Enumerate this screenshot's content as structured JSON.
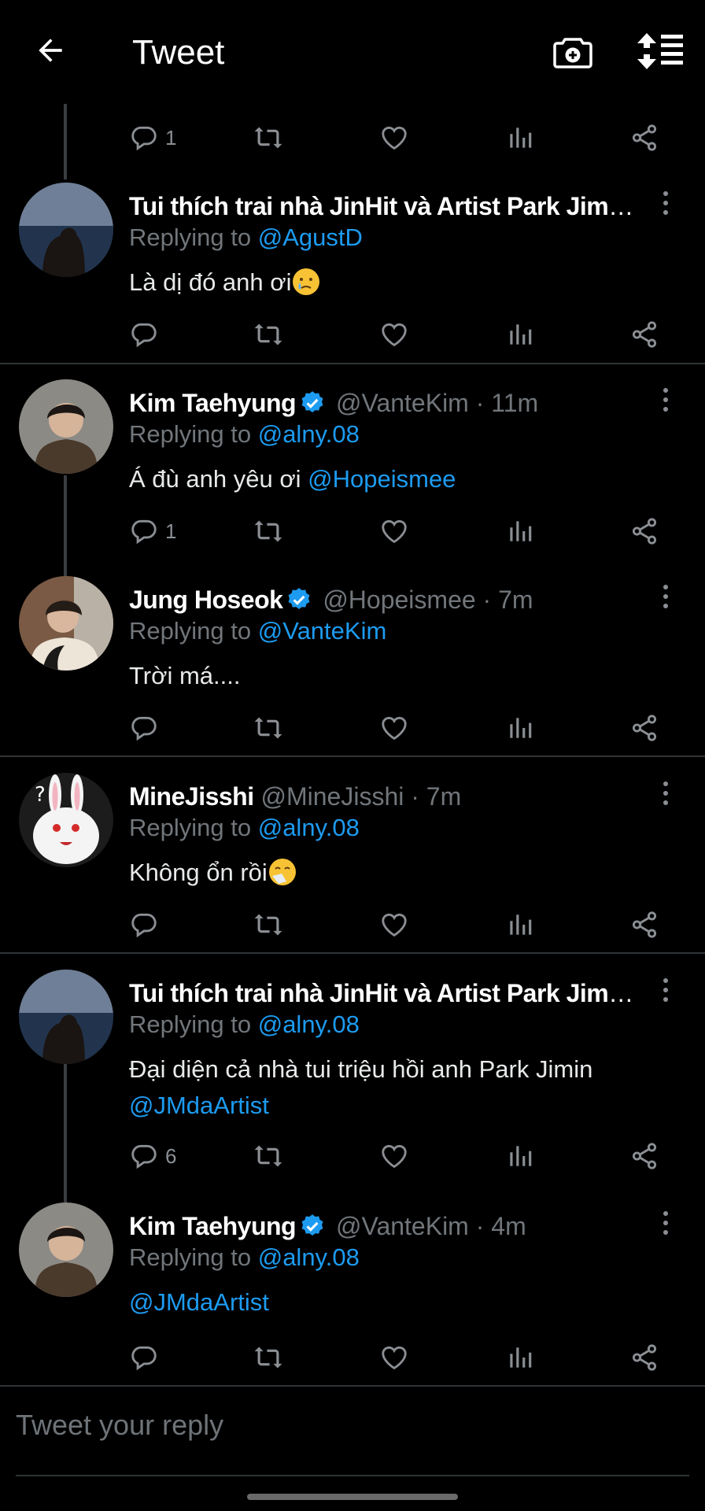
{
  "header": {
    "title": "Tweet",
    "back_icon": "arrow-left-icon",
    "camera_icon": "camera-plus-icon",
    "sort_icon": "sort-replies-icon"
  },
  "colors": {
    "background": "#000000",
    "accent": "#1d9bf0",
    "secondary_text": "#71767b",
    "divider": "#2f3336"
  },
  "top_actions": {
    "reply_count": "1"
  },
  "tweets": [
    {
      "name": "Tui thích trai nhà JinHit và Artist Park Jimin ...",
      "verified": false,
      "handle": "",
      "time": "",
      "replying_label": "Replying to",
      "replying_to": "@AgustD",
      "text": "Là dị đó anh ơi",
      "emoji": "crying-face-emoji",
      "reply_count": ""
    },
    {
      "name": "Kim Taehyung",
      "verified": true,
      "handle": "@VanteKim",
      "time": "· 11m",
      "replying_label": "Replying to",
      "replying_to": "@alny.08",
      "text": "Á đù anh yêu ơi ",
      "mention": "@Hopeismee",
      "reply_count": "1"
    },
    {
      "name": "Jung Hoseok",
      "verified": true,
      "handle": "@Hopeismee",
      "time": "· 7m",
      "replying_label": "Replying to",
      "replying_to": "@VanteKim",
      "text": "Trời má....",
      "reply_count": ""
    },
    {
      "name": "MineJisshi",
      "verified": false,
      "handle": "@MineJisshi",
      "time": "· 7m",
      "replying_label": "Replying to",
      "replying_to": "@alny.08",
      "text": "Không ổn rồi",
      "emoji": "sneezing-face-emoji",
      "reply_count": ""
    },
    {
      "name": "Tui thích trai nhà JinHit và Artist Park Jimin ...",
      "verified": false,
      "handle": "",
      "time": "",
      "replying_label": "Replying to",
      "replying_to": "@alny.08",
      "text": "Đại diện cả nhà tui triệu hồi anh Park Jimin",
      "mention": "@JMdaArtist",
      "reply_count": "6"
    },
    {
      "name": "Kim Taehyung",
      "verified": true,
      "handle": "@VanteKim",
      "time": "· 4m",
      "replying_label": "Replying to",
      "replying_to": "@alny.08",
      "text": "",
      "mention": "@JMdaArtist",
      "reply_count": ""
    }
  ],
  "composer": {
    "placeholder": "Tweet your reply"
  }
}
